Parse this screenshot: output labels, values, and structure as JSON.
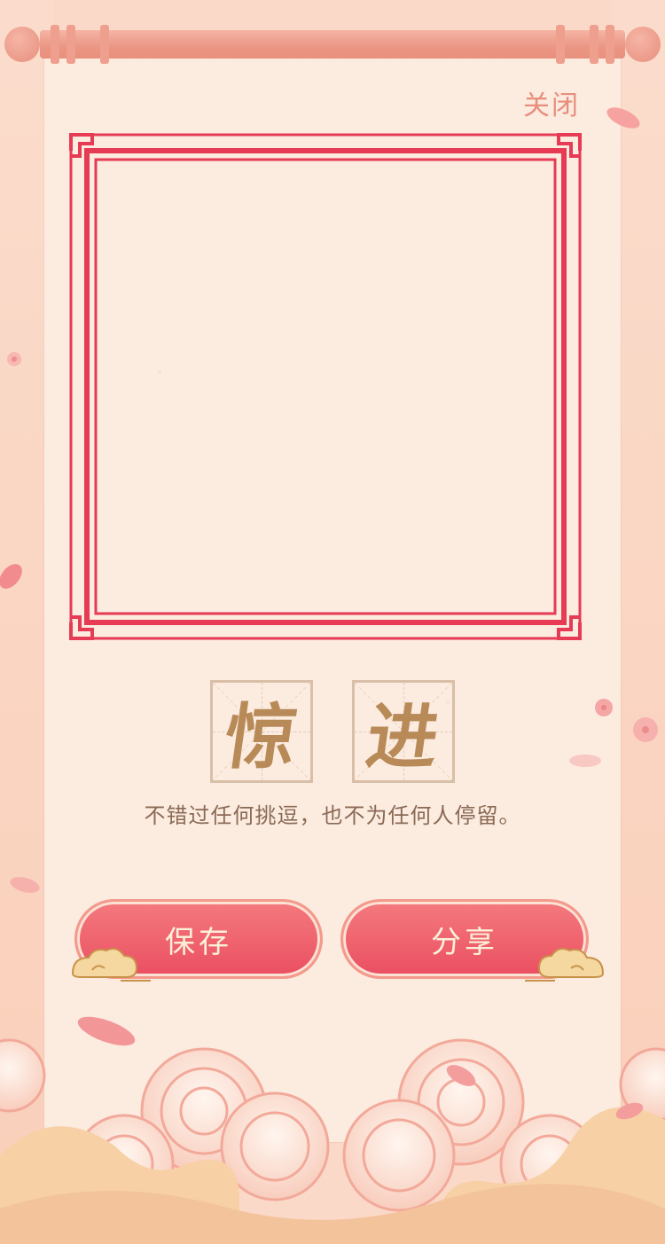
{
  "header": {
    "close_label": "关闭"
  },
  "title_chars": [
    "惊",
    "进"
  ],
  "quote": "不错过任何挑逗，也不为任何人停留。",
  "actions": {
    "save_label": "保存",
    "share_label": "分享"
  },
  "colors": {
    "frame": "#e63a55",
    "button": "#ec5465",
    "char": "#b88a58",
    "close": "#e88e7d"
  }
}
